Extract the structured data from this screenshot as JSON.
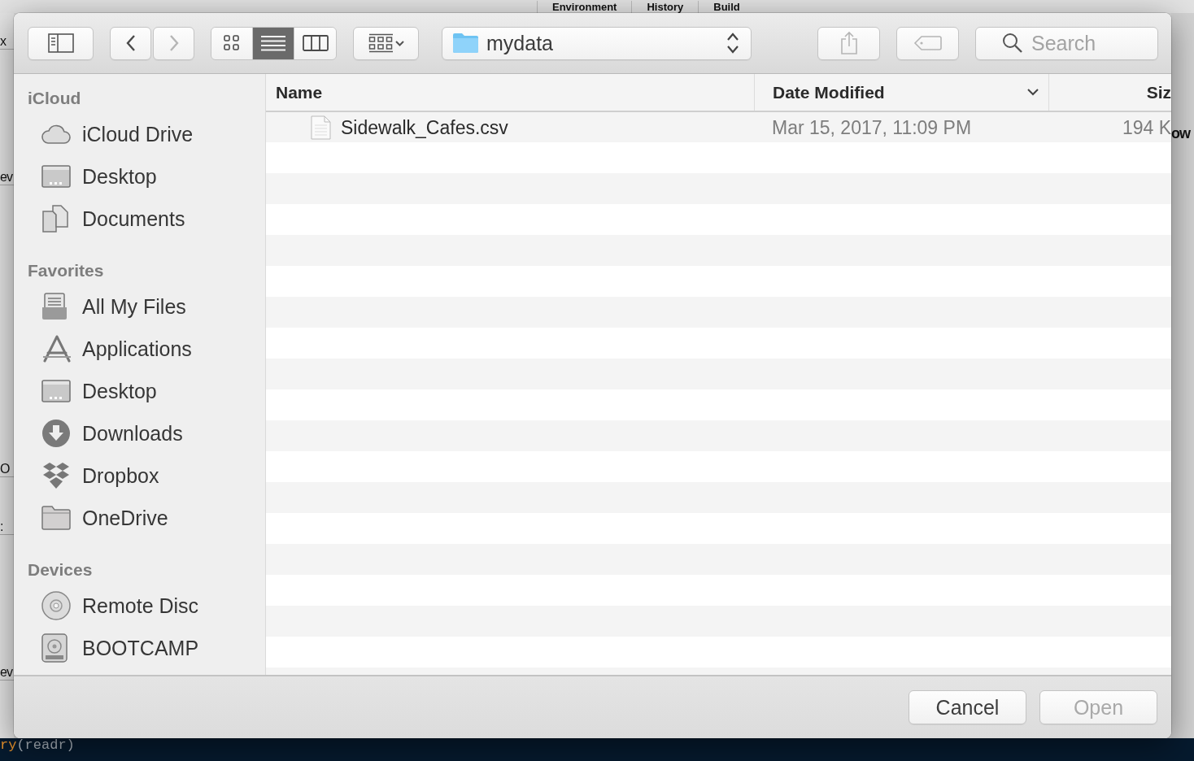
{
  "backdrop": {
    "tabs": [
      "Environment",
      "History",
      "Build"
    ],
    "left_fragments": [
      "x",
      "ev",
      "O",
      ":",
      "ev"
    ],
    "right_fragment": "ow",
    "console": {
      "function": "ry",
      "args": "(readr)"
    }
  },
  "toolbar": {
    "nav": [
      {
        "kind": "back",
        "disabled": false
      },
      {
        "kind": "forward",
        "disabled": true
      }
    ],
    "view_modes": [
      {
        "kind": "icons",
        "selected": false
      },
      {
        "kind": "list",
        "selected": true
      },
      {
        "kind": "columns",
        "selected": false
      }
    ],
    "location": "mydata",
    "actions": [
      {
        "kind": "share",
        "disabled": true
      },
      {
        "kind": "tag",
        "disabled": true
      }
    ],
    "search": {
      "placeholder": "Search"
    }
  },
  "sidebar": {
    "sections": [
      {
        "title": "iCloud",
        "items": [
          {
            "label": "iCloud Drive",
            "kind": "cloud"
          },
          {
            "label": "Desktop",
            "kind": "desktop"
          },
          {
            "label": "Documents",
            "kind": "documents"
          }
        ]
      },
      {
        "title": "Favorites",
        "items": [
          {
            "label": "All My Files",
            "kind": "allfiles"
          },
          {
            "label": "Applications",
            "kind": "applications"
          },
          {
            "label": "Desktop",
            "kind": "desktop"
          },
          {
            "label": "Downloads",
            "kind": "downloads"
          },
          {
            "label": "Dropbox",
            "kind": "dropbox"
          },
          {
            "label": "OneDrive",
            "kind": "folder"
          }
        ]
      },
      {
        "title": "Devices",
        "items": [
          {
            "label": "Remote Disc",
            "kind": "disc"
          },
          {
            "label": "BOOTCAMP",
            "kind": "drive"
          }
        ]
      }
    ]
  },
  "table": {
    "columns": [
      {
        "label": "Name",
        "sorted": false
      },
      {
        "label": "Date Modified",
        "sorted": true
      },
      {
        "label": "Siz",
        "sorted": false
      }
    ],
    "rows": [
      {
        "name": "Sidewalk_Cafes.csv",
        "date": "Mar 15, 2017, 11:09 PM",
        "size": "194 K",
        "selected": false
      }
    ]
  },
  "buttons": [
    {
      "label": "Cancel",
      "disabled": false
    },
    {
      "label": "Open",
      "disabled": true
    }
  ]
}
